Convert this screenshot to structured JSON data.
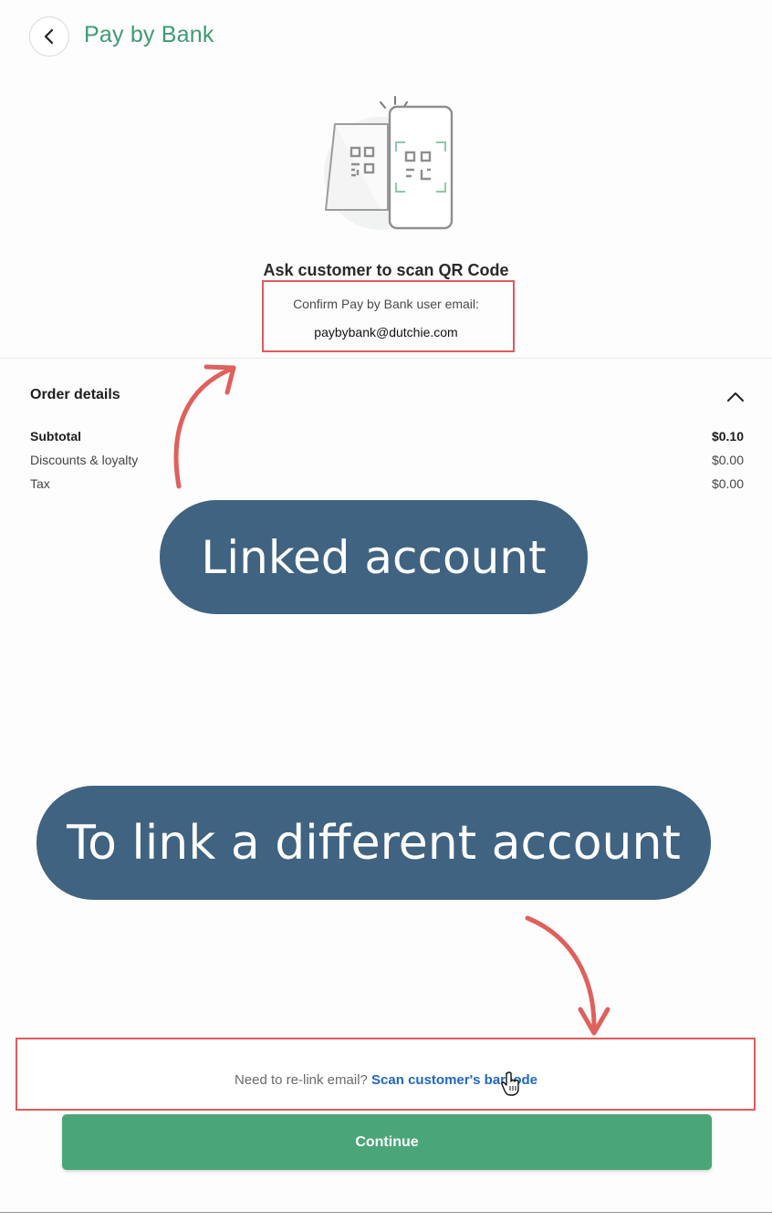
{
  "header": {
    "title": "Pay by Bank"
  },
  "scan": {
    "title": "Ask customer to scan QR Code",
    "email_label": "Confirm Pay by Bank user email:",
    "email_value": "paybybank@dutchie.com"
  },
  "order": {
    "title": "Order details",
    "rows": [
      {
        "label": "Subtotal",
        "value": "$0.10"
      },
      {
        "label": "Discounts & loyalty",
        "value": "$0.00"
      },
      {
        "label": "Tax",
        "value": "$0.00"
      }
    ]
  },
  "annotations": {
    "linked": "Linked account",
    "link_different": "To link a different account",
    "highlight_color": "#e15b5b",
    "callout_color": "#3f6381"
  },
  "footer": {
    "relink_text": "Need to re-link email?",
    "relink_link": "Scan customer's barcode",
    "continue_label": "Continue"
  },
  "colors": {
    "brand": "#3e9b72",
    "button": "#4aa679",
    "link": "#1f67c5"
  }
}
